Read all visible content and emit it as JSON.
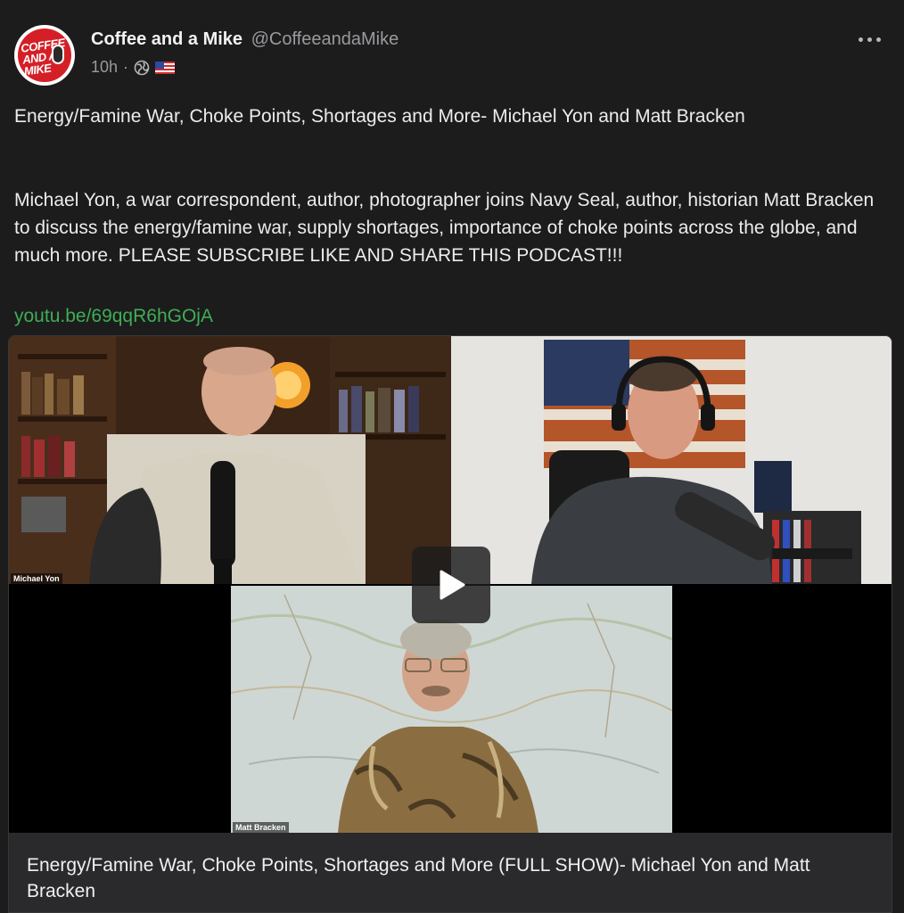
{
  "author": {
    "display_name": "Coffee and a Mike",
    "handle": "@CoffeeandaMike",
    "avatar_text": "COFFEE AND A MIKE"
  },
  "meta": {
    "time": "10h",
    "separator": "·",
    "visibility_icon": "globe-icon",
    "language_flag": "us-flag-icon"
  },
  "post": {
    "title": "Energy/Famine War, Choke Points, Shortages and More- Michael Yon and Matt Bracken",
    "description": "Michael Yon, a war correspondent, author, photographer joins Navy Seal, author, historian Matt Bracken to discuss the energy/famine war, supply shortages, importance of choke points across the globe, and much more. PLEASE SUBSCRIBE LIKE AND SHARE THIS PODCAST!!!",
    "link": "youtu.be/69qqR6hGOjA"
  },
  "video": {
    "speaker_top_left": "Michael Yon",
    "speaker_bottom": "Matt Bracken",
    "caption": "Energy/Famine War, Choke Points, Shortages and More (FULL SHOW)- Michael Yon and Matt Bracken"
  },
  "colors": {
    "background": "#1c1c1d",
    "link": "#3fae54",
    "avatar_red": "#d51f26"
  }
}
